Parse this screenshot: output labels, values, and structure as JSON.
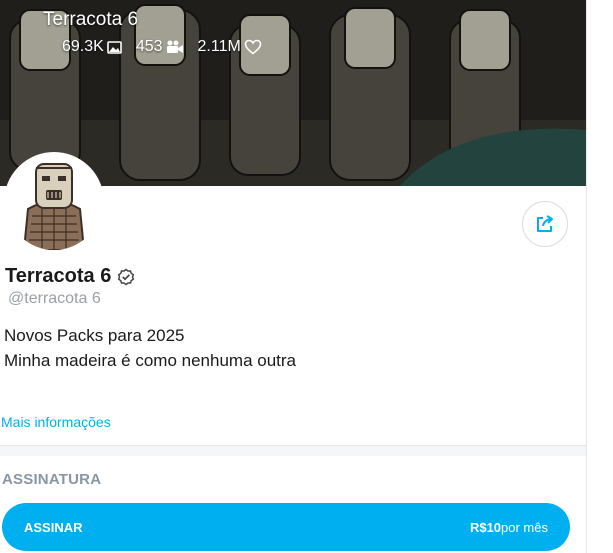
{
  "banner": {
    "title": "Terracota 6",
    "stats": [
      {
        "value": "69.3K",
        "icon": "image-icon"
      },
      {
        "value": "453",
        "icon": "video-camera-icon"
      },
      {
        "value": "2.11M",
        "icon": "heart-icon"
      }
    ]
  },
  "profile": {
    "name": "Terracota 6",
    "handle": "@terracota 6",
    "bio": [
      "Novos Packs para 2025",
      "Minha madeira é como nenhuma outra"
    ],
    "more_link": "Mais informações"
  },
  "subscription": {
    "section_title": "ASSINATURA",
    "button_label": "ASSINAR",
    "price_amount": "R$10",
    "price_period": "por mês"
  },
  "colors": {
    "accent": "#00aff0",
    "muted": "#8a96a3"
  }
}
